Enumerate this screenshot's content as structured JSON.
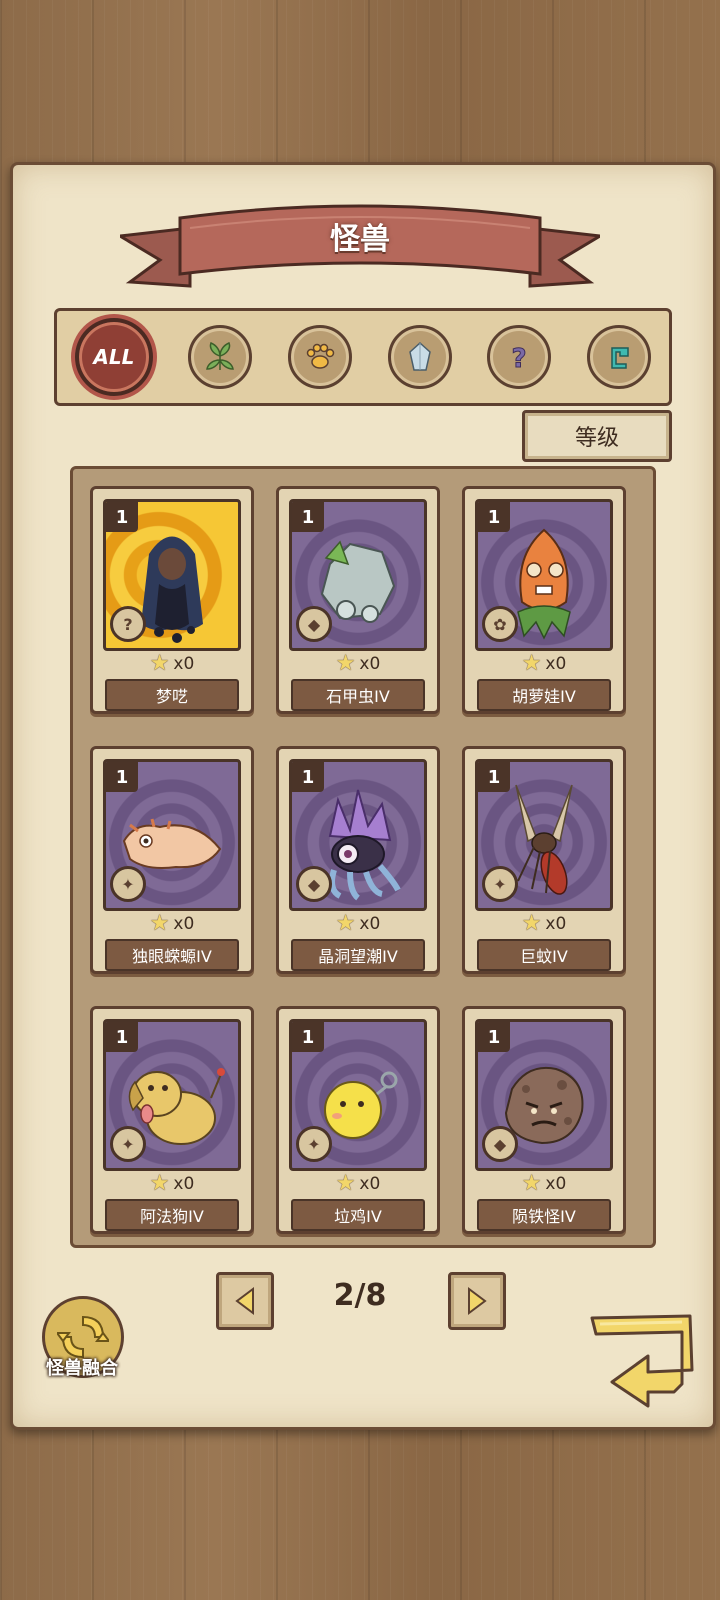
{
  "header": {
    "title": "怪兽"
  },
  "filters": [
    {
      "id": "all",
      "label": "ALL",
      "active": true
    },
    {
      "id": "plant",
      "icon": "leaf-icon"
    },
    {
      "id": "beast",
      "icon": "paw-icon"
    },
    {
      "id": "mineral",
      "icon": "crystal-icon"
    },
    {
      "id": "unknown",
      "icon": "question-icon"
    },
    {
      "id": "machine",
      "icon": "gear-icon"
    }
  ],
  "sort": {
    "label": "等级"
  },
  "cards": [
    {
      "level": "1",
      "stars": "x0",
      "name": "梦呓",
      "type": "question-icon",
      "art": "gold"
    },
    {
      "level": "1",
      "stars": "x0",
      "name": "石甲虫IV",
      "type": "crystal-icon",
      "art": "purple"
    },
    {
      "level": "1",
      "stars": "x0",
      "name": "胡萝娃IV",
      "type": "leaf-icon",
      "art": "purple"
    },
    {
      "level": "1",
      "stars": "x0",
      "name": "独眼蝾螈IV",
      "type": "paw-icon",
      "art": "purple"
    },
    {
      "level": "1",
      "stars": "x0",
      "name": "晶洞望潮IV",
      "type": "crystal-icon",
      "art": "purple"
    },
    {
      "level": "1",
      "stars": "x0",
      "name": "巨蚊IV",
      "type": "paw-icon",
      "art": "purple"
    },
    {
      "level": "1",
      "stars": "x0",
      "name": "阿法狗IV",
      "type": "paw-icon",
      "art": "purple"
    },
    {
      "level": "1",
      "stars": "x0",
      "name": "垃鸡IV",
      "type": "paw-icon",
      "art": "purple"
    },
    {
      "level": "1",
      "stars": "x0",
      "name": "陨铁怪IV",
      "type": "crystal-icon",
      "art": "purple"
    }
  ],
  "pagination": {
    "current": "2/8"
  },
  "fusion": {
    "label": "怪兽融合"
  },
  "colors": {
    "accent": "#8f3f35",
    "frame": "#5d4030",
    "paper": "#efe4c8",
    "gold": "#f4c030"
  }
}
